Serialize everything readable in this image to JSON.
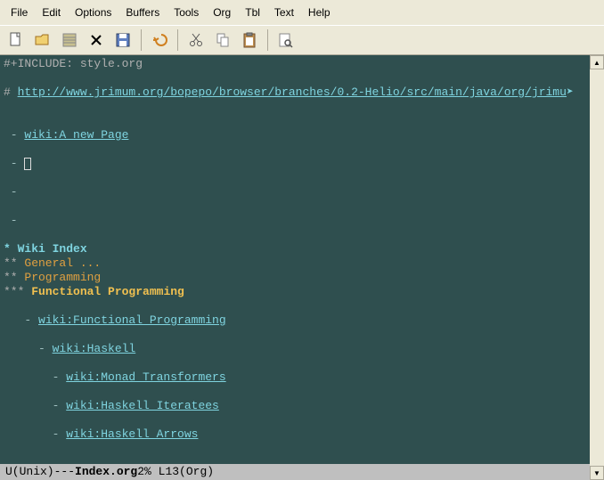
{
  "menu": [
    "File",
    "Edit",
    "Options",
    "Buffers",
    "Tools",
    "Org",
    "Tbl",
    "Text",
    "Help"
  ],
  "editor": {
    "include_line": "#+INCLUDE: style.org",
    "url_prefix": "# ",
    "url": "http://www.jrimum.org/bopepo/browser/branches/0.2-Helio/src/main/java/org/jrimu",
    "trunc": "➤",
    "bullets_top": [
      {
        "dash": " - ",
        "link": "wiki:A_new_Page"
      },
      {
        "dash": " - ",
        "cursor": true
      },
      {
        "dash": " -"
      },
      {
        "dash": " -"
      }
    ],
    "h1_stars": "* ",
    "h1": "Wiki Index",
    "h2a_stars": "** ",
    "h2a": "General ...",
    "h2b_stars": "** ",
    "h2b": "Programming",
    "h3_stars": "*** ",
    "h3": "Functional Programming",
    "links": [
      {
        "indent": "   - ",
        "text": "wiki:Functional_Programming"
      },
      {
        "indent": "     - ",
        "text": "wiki:Haskell"
      },
      {
        "indent": "       - ",
        "text": "wiki:Monad_Transformers"
      },
      {
        "indent": "       - ",
        "text": "wiki:Haskell_Iteratees"
      },
      {
        "indent": "       - ",
        "text": "wiki:Haskell_Arrows"
      }
    ]
  },
  "status": {
    "left": "U(Unix)---  ",
    "file": "Index.org",
    "pos": "      2% L13    ",
    "mode": "(Org)"
  }
}
